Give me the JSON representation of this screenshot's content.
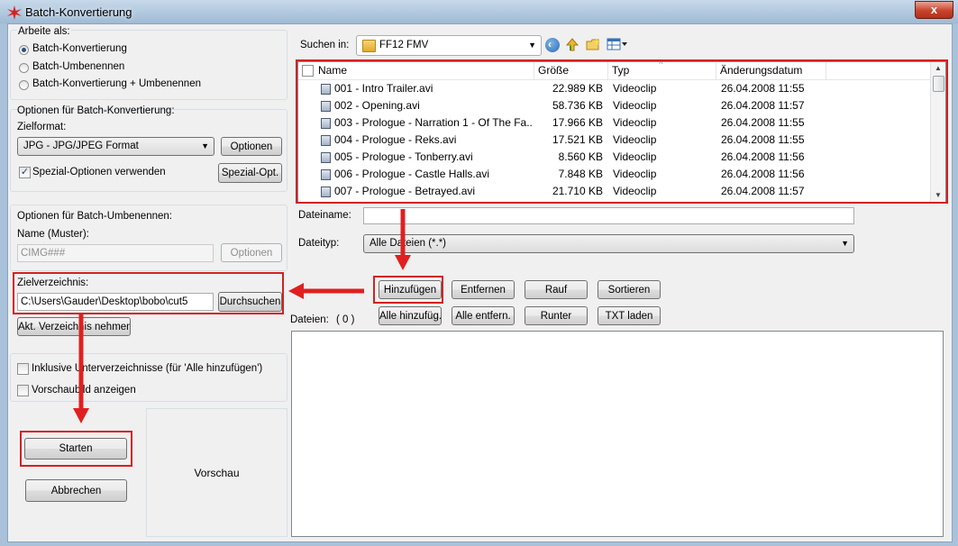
{
  "window": {
    "title": "Batch-Konvertierung",
    "close_label": "x"
  },
  "colors": {
    "annotation_red": "#d42020",
    "title_gradient_top": "#c7d9ea",
    "close_red": "#c7432b"
  },
  "left": {
    "work_as": {
      "legend": "Arbeite als:",
      "options": [
        "Batch-Konvertierung",
        "Batch-Umbenennen",
        "Batch-Konvertierung + Umbenennen"
      ],
      "selected": "Batch-Konvertierung"
    },
    "convert": {
      "legend": "Optionen für Batch-Konvertierung:",
      "target_format_label": "Zielformat:",
      "target_format_value": "JPG - JPG/JPEG Format",
      "options_button": "Optionen",
      "special_checkbox_label": "Spezial-Optionen verwenden",
      "special_checked": true,
      "special_button": "Spezial-Opt."
    },
    "rename": {
      "legend": "Optionen für Batch-Umbenennen:",
      "name_label": "Name (Muster):",
      "name_value": "CIMG###",
      "options_button": "Optionen"
    },
    "target_dir": {
      "label": "Zielverzeichnis:",
      "value": "C:\\Users\\Gauder\\Desktop\\bobo\\cut5",
      "browse_button": "Durchsuchen",
      "take_current_button": "Akt. Verzeichnis nehmen"
    },
    "checks": {
      "subdirs_label": "Inklusive Unterverzeichnisse (für 'Alle hinzufügen')",
      "subdirs_checked": false,
      "preview_label": "Vorschaubild anzeigen",
      "preview_checked": false
    },
    "start_button": "Starten",
    "cancel_button": "Abbrechen",
    "preview_label": "Vorschau"
  },
  "browser": {
    "look_in_label": "Suchen in:",
    "folder": "FF12 FMV",
    "columns": [
      "Name",
      "Größe",
      "Typ",
      "Änderungsdatum"
    ],
    "files": [
      {
        "name": "001 - Intro Trailer.avi",
        "size": "22.989 KB",
        "type": "Videoclip",
        "date": "26.04.2008 11:55"
      },
      {
        "name": "002 - Opening.avi",
        "size": "58.736 KB",
        "type": "Videoclip",
        "date": "26.04.2008 11:57"
      },
      {
        "name": "003 - Prologue - Narration 1 - Of The Fa...",
        "size": "17.966 KB",
        "type": "Videoclip",
        "date": "26.04.2008 11:55"
      },
      {
        "name": "004 - Prologue - Reks.avi",
        "size": "17.521 KB",
        "type": "Videoclip",
        "date": "26.04.2008 11:55"
      },
      {
        "name": "005 - Prologue - Tonberry.avi",
        "size": "8.560 KB",
        "type": "Videoclip",
        "date": "26.04.2008 11:56"
      },
      {
        "name": "006 - Prologue - Castle Halls.avi",
        "size": "7.848 KB",
        "type": "Videoclip",
        "date": "26.04.2008 11:56"
      },
      {
        "name": "007 - Prologue - Betrayed.avi",
        "size": "21.710 KB",
        "type": "Videoclip",
        "date": "26.04.2008 11:57"
      }
    ],
    "filename_label": "Dateiname:",
    "filename_value": "",
    "filetype_label": "Dateityp:",
    "filetype_value": "Alle Dateien (*.*)"
  },
  "queue": {
    "buttons_row1": [
      "Hinzufügen",
      "Entfernen",
      "Rauf",
      "Sortieren"
    ],
    "buttons_row2": [
      "Alle hinzufüg.",
      "Alle entfern.",
      "Runter",
      "TXT laden"
    ],
    "files_label": "Dateien:",
    "files_count": "( 0 )"
  }
}
